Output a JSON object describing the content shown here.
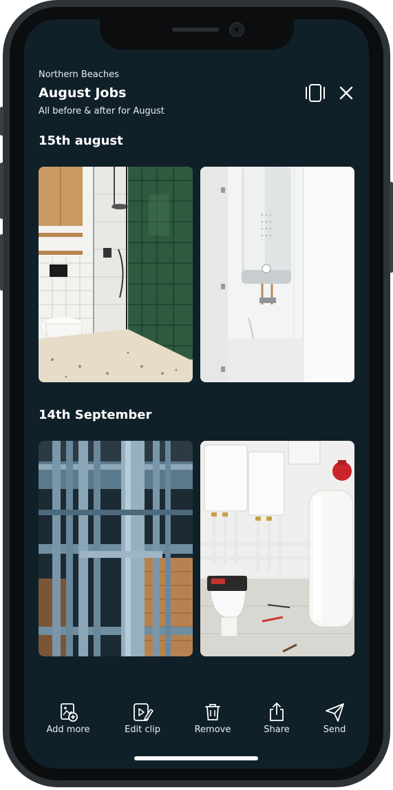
{
  "header": {
    "location": "Northern Beaches",
    "title": "August Jobs",
    "subtitle": "All before & after for August"
  },
  "sections": [
    {
      "label": "15th august",
      "photos": [
        "shower-bathroom-photo",
        "water-heater-photo"
      ]
    },
    {
      "label": "14th September",
      "photos": [
        "pipes-photo",
        "boiler-room-photo"
      ]
    }
  ],
  "toolbar": {
    "add_more": "Add more",
    "edit_clip": "Edit clip",
    "remove": "Remove",
    "share": "Share",
    "send": "Send"
  },
  "icons": {
    "vibrate": "vibrate-icon",
    "close": "close-icon",
    "add_more": "add-image-icon",
    "edit_clip": "edit-clip-icon",
    "remove": "trash-icon",
    "share": "share-icon",
    "send": "send-icon"
  },
  "colors": {
    "background": "#102029",
    "text": "#ffffff"
  }
}
